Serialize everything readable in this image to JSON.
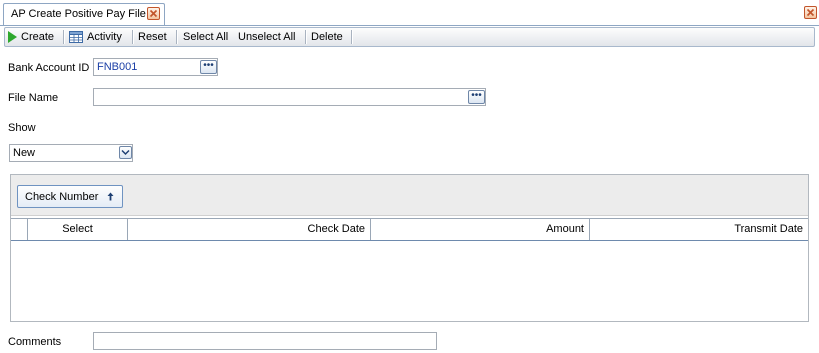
{
  "tab": {
    "title": "AP Create Positive Pay File"
  },
  "toolbar": {
    "create": "Create",
    "activity": "Activity",
    "reset": "Reset",
    "select_all": "Select All",
    "unselect_all": "Unselect All",
    "delete": "Delete"
  },
  "form": {
    "bank_account_label": "Bank Account ID",
    "bank_account_value": "FNB001",
    "file_name_label": "File Name",
    "file_name_value": "",
    "show_label": "Show",
    "show_value": "New",
    "comments_label": "Comments",
    "comments_value": ""
  },
  "grid": {
    "sort_button": "Check Number",
    "columns": [
      "Select",
      "Check Date",
      "Amount",
      "Transmit Date"
    ],
    "rows": []
  },
  "icons": {
    "create": "play-icon",
    "activity": "grid-icon",
    "close": "close-icon",
    "lookup": "ellipsis-icon",
    "dropdown": "chevron-down-icon",
    "sort": "arrow-up-icon"
  },
  "colors": {
    "create_icon": "#2ea82e",
    "field_value": "#1b3fa6",
    "close_icon": "#c2552b"
  }
}
